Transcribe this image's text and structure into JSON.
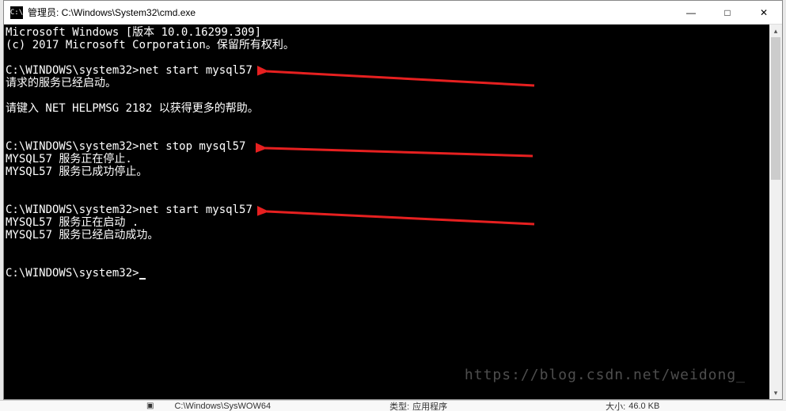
{
  "titlebar": {
    "icon_label": "C:\\",
    "title": "管理员: C:\\Windows\\System32\\cmd.exe"
  },
  "window_controls": {
    "minimize": "—",
    "maximize": "□",
    "close": "✕"
  },
  "terminal": {
    "line1": "Microsoft Windows [版本 10.0.16299.309]",
    "line2": "(c) 2017 Microsoft Corporation。保留所有权利。",
    "cmd1_prompt": "C:\\WINDOWS\\system32>",
    "cmd1_input": "net start mysql57",
    "cmd1_out1": "请求的服务已经启动。",
    "cmd1_out2": "请键入 NET HELPMSG 2182 以获得更多的帮助。",
    "cmd2_prompt": "C:\\WINDOWS\\system32>",
    "cmd2_input": "net stop mysql57",
    "cmd2_out1": "MYSQL57 服务正在停止.",
    "cmd2_out2": "MYSQL57 服务已成功停止。",
    "cmd3_prompt": "C:\\WINDOWS\\system32>",
    "cmd3_input": "net start mysql57",
    "cmd3_out1": "MYSQL57 服务正在启动 .",
    "cmd3_out2": "MYSQL57 服务已经启动成功。",
    "cmd4_prompt": "C:\\WINDOWS\\system32>"
  },
  "watermark": "https://blog.csdn.net/weidong_",
  "taskbar": {
    "path": "C:\\Windows\\SysWOW64",
    "type_label": "类型:",
    "type_value": "应用程序",
    "size_label": "大小:",
    "size_value": "46.0 KB"
  },
  "annotations": {
    "arrow_color": "#e62020"
  }
}
